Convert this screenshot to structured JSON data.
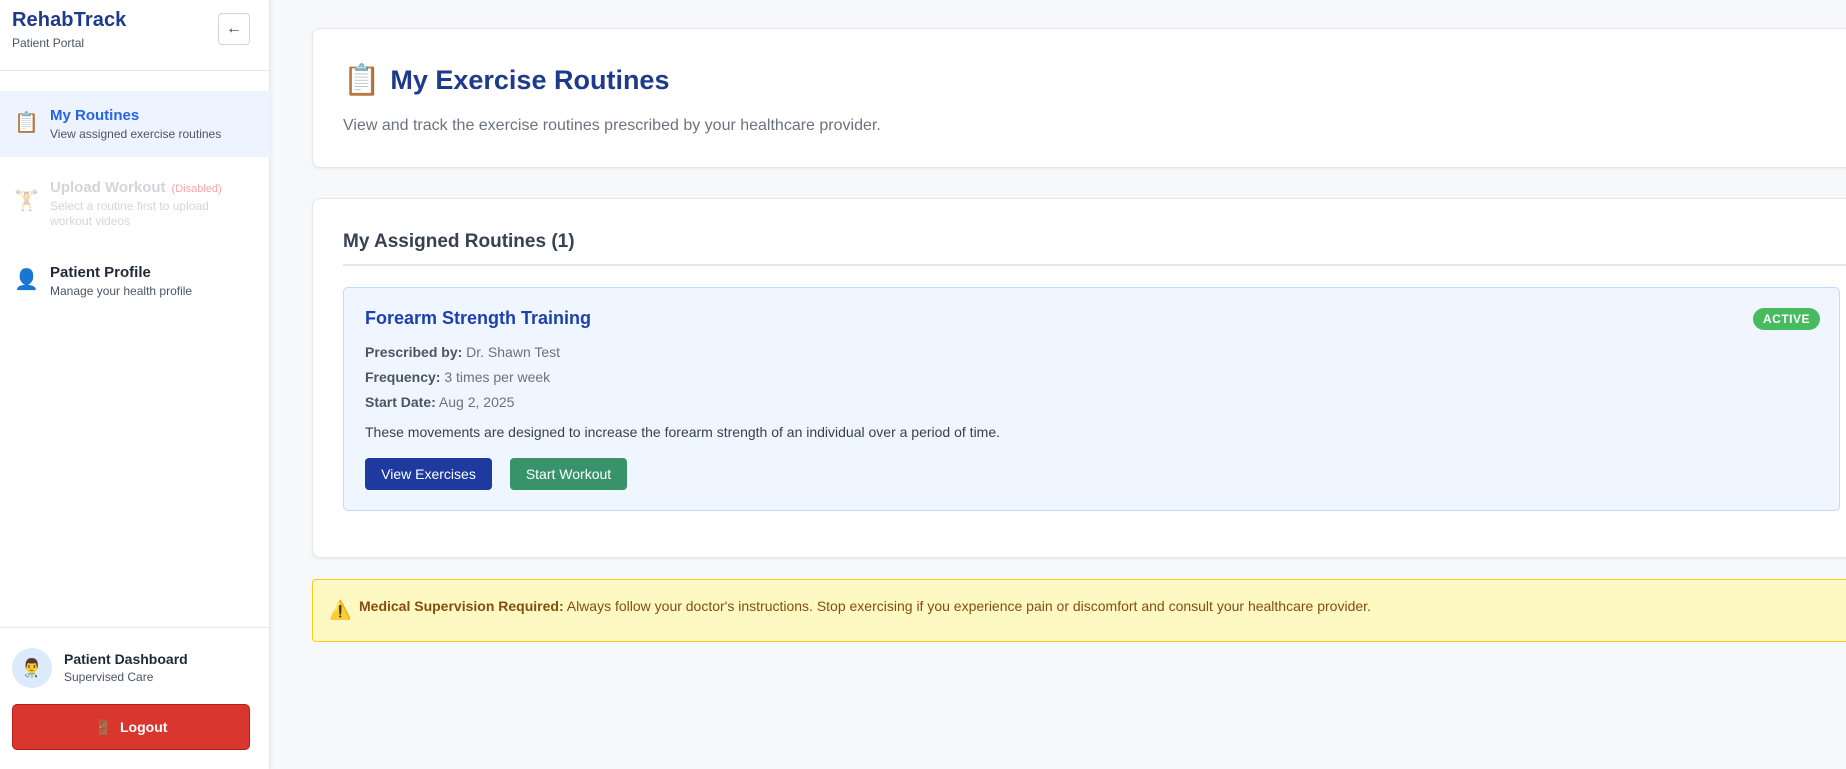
{
  "brand": {
    "title": "RehabTrack",
    "subtitle": "Patient Portal",
    "collapse_icon": "←"
  },
  "sidebar": {
    "items": [
      {
        "icon": "📋",
        "label": "My Routines",
        "desc": "View assigned exercise routines",
        "active": true
      },
      {
        "icon": "🏋",
        "label": "Upload Workout",
        "badge": "(Disabled)",
        "desc": "Select a routine first to upload workout videos",
        "disabled": true
      },
      {
        "icon": "👤",
        "label": "Patient Profile",
        "desc": "Manage your health profile"
      }
    ]
  },
  "user": {
    "avatar": "👨‍⚕️",
    "name": "Patient Dashboard",
    "role": "Supervised Care"
  },
  "logout": {
    "icon": "🚪",
    "label": "Logout"
  },
  "header": {
    "icon": "📋",
    "title": "My Exercise Routines",
    "subtitle": "View and track the exercise routines prescribed by your healthcare provider."
  },
  "routines": {
    "heading": "My Assigned Routines (1)",
    "items": [
      {
        "name": "Forearm Strength Training",
        "status": "ACTIVE",
        "prescribed_label": "Prescribed by:",
        "prescribed_value": "Dr. Shawn Test",
        "frequency_label": "Frequency:",
        "frequency_value": "3 times per week",
        "start_label": "Start Date:",
        "start_value": "Aug 2, 2025",
        "description": "These movements are designed to increase the forearm strength of an individual over a period of time.",
        "view_label": "View Exercises",
        "start_workout_label": "Start Workout"
      }
    ]
  },
  "warning": {
    "icon": "⚠️",
    "title": "Medical Supervision Required:",
    "text": "Always follow your doctor's instructions. Stop exercising if you experience pain or discomfort and consult your healthcare provider."
  },
  "colors": {
    "brand": "#1e3a8a",
    "active_nav": "#2563eb",
    "success": "#48bb60",
    "logout": "#d9372e",
    "warning_bg": "#fef9c3"
  }
}
